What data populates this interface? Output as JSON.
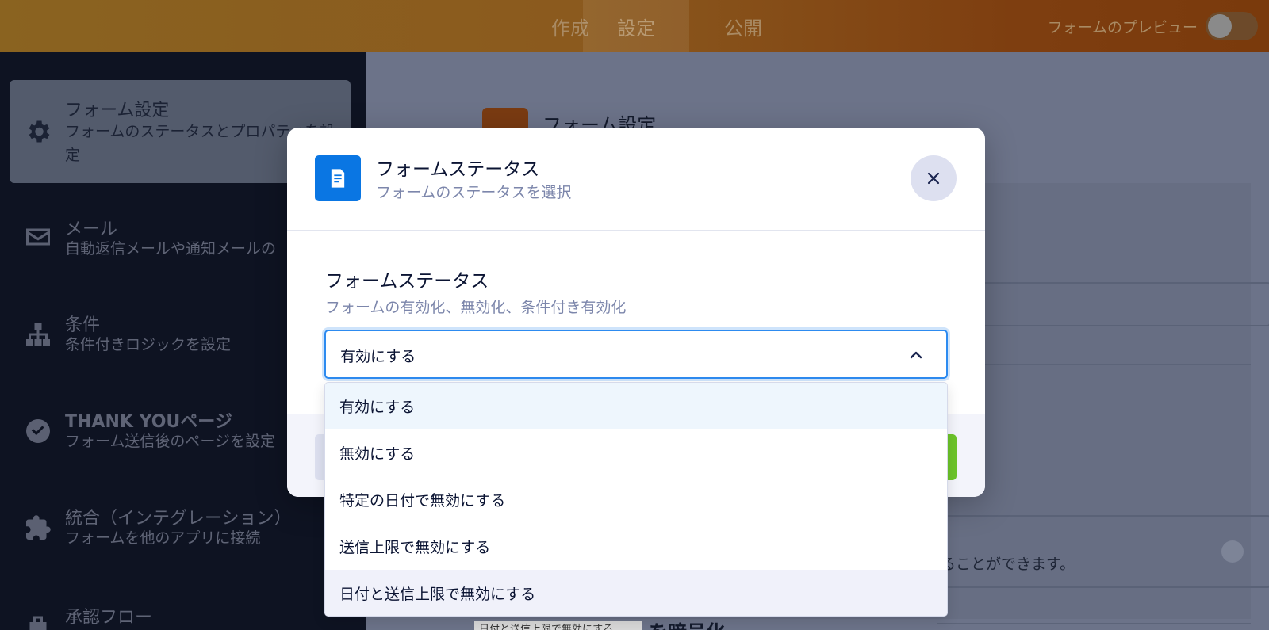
{
  "topbar": {
    "tabs": [
      "作成",
      "設定",
      "公開"
    ],
    "active_tab": "設定",
    "preview_label": "フォームのプレビュー"
  },
  "sidebar": {
    "items": [
      {
        "title": "フォーム設定",
        "subtitle": "フォームのステータスとプロパティを設定",
        "icon": "gear-icon"
      },
      {
        "title": "メール",
        "subtitle": "自動返信メールや通知メールの",
        "icon": "mail-icon"
      },
      {
        "title": "条件",
        "subtitle": "条件付きロジックを設定",
        "icon": "sitemap-icon"
      },
      {
        "title": "THANK YOUページ",
        "subtitle": "フォーム送信後のページを設定",
        "icon": "check-circle-icon"
      },
      {
        "title": "統合（インテグレーション）",
        "subtitle": "フォームを他のアプリに接続",
        "icon": "puzzle-icon"
      },
      {
        "title": "承認フロー",
        "subtitle": "",
        "icon": "approval-icon"
      }
    ]
  },
  "main": {
    "title": "フォーム設定",
    "card_text": "ることができます。",
    "chip_text": "日付と送信上限で無効にする",
    "bottom_title": "を暗号化"
  },
  "modal": {
    "title": "フォームステータス",
    "subtitle": "フォームのステータスを選択",
    "field_label": "フォームステータス",
    "field_desc": "フォームの有効化、無効化、条件付き有効化",
    "selected_value": "有効にする",
    "options": [
      "有効にする",
      "無効にする",
      "特定の日付で無効にする",
      "送信上限で無効にする",
      "日付と送信上限で無効にする"
    ]
  },
  "colors": {
    "primary_blue": "#0a76e3",
    "focus_border": "#2d8bf0",
    "success_green": "#6cc42a",
    "sidebar_bg": "#0e1322",
    "topbar_orange": "#7e3e10"
  }
}
